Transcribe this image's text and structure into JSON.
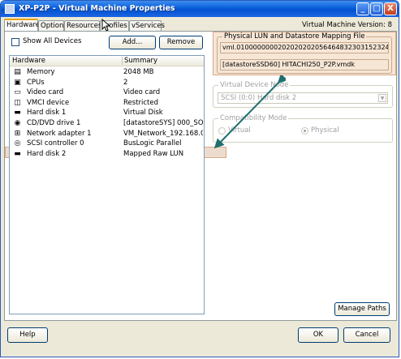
{
  "window": {
    "title": "XP-P2P - Virtual Machine Properties",
    "min": "_",
    "max": "□",
    "close": "X"
  },
  "tabs": [
    "Hardware",
    "Options",
    "Resources",
    "Profiles",
    "vServices"
  ],
  "vm_version": "Virtual Machine Version: 8",
  "toolbar": {
    "show_all": "Show All Devices",
    "add": "Add...",
    "remove": "Remove"
  },
  "list": {
    "col_hardware": "Hardware",
    "col_summary": "Summary",
    "rows": [
      {
        "icon": "memory-icon",
        "glyph": "▤",
        "hardware": "Memory",
        "summary": "2048 MB"
      },
      {
        "icon": "cpu-icon",
        "glyph": "▣",
        "hardware": "CPUs",
        "summary": "2"
      },
      {
        "icon": "video-card-icon",
        "glyph": "▭",
        "hardware": "Video card",
        "summary": "Video card"
      },
      {
        "icon": "vmci-icon",
        "glyph": "◫",
        "hardware": "VMCI device",
        "summary": "Restricted"
      },
      {
        "icon": "hard-disk-icon",
        "glyph": "▬",
        "hardware": "Hard disk 1",
        "summary": "Virtual Disk"
      },
      {
        "icon": "cd-dvd-icon",
        "glyph": "◉",
        "hardware": "CD/DVD drive 1",
        "summary": "[datastoreSYS] 000_SO..."
      },
      {
        "icon": "network-adapter-icon",
        "glyph": "⊞",
        "hardware": "Network adapter 1",
        "summary": "VM_Network_192.168.0...."
      },
      {
        "icon": "scsi-controller-icon",
        "glyph": "◎",
        "hardware": "SCSI controller 0",
        "summary": "BusLogic Parallel"
      },
      {
        "icon": "hard-disk-icon",
        "glyph": "▬",
        "hardware": "Hard disk 2",
        "summary": "Mapped Raw LUN"
      }
    ]
  },
  "right": {
    "lun_title": "Physical LUN and Datastore Mapping File",
    "lun_id": "vml.01000000002020202020564648323031523245386563",
    "mapping_file": "[datastoreSSD60] HITACHI250_P2P.vmdk",
    "vdn_title": "Virtual Device Node",
    "vdn_value": "SCSI (0:0) Hard disk 2",
    "compat_title": "Compatibility Mode",
    "virtual": "Virtual",
    "physical": "Physical",
    "manage_paths": "Manage Paths"
  },
  "footer": {
    "help": "Help",
    "ok": "OK",
    "cancel": "Cancel"
  },
  "colors": {
    "highlight": "#eddccd",
    "highlight_border": "#d9a98c",
    "arrow": "#1f6f6f"
  }
}
